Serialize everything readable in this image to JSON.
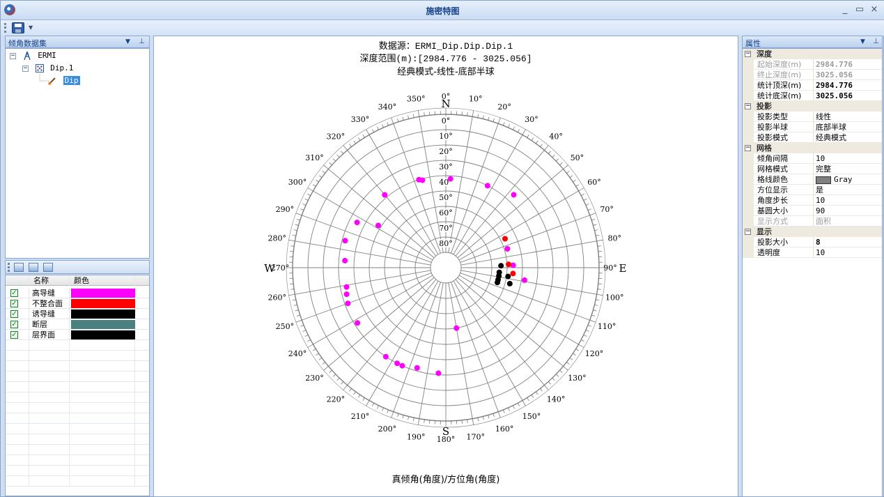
{
  "window": {
    "title": "施密特图"
  },
  "titlebar": {
    "minimize": "_",
    "maximize": "▭",
    "close": "×"
  },
  "left_panel": {
    "title": "倾角数据集",
    "tree": [
      {
        "label": "ERMI",
        "icon": "well-icon",
        "level": 0
      },
      {
        "label": "Dip.1",
        "icon": "dataset-icon",
        "level": 1
      },
      {
        "label": "Dip",
        "icon": "curve-icon",
        "level": 2,
        "selected": true
      }
    ]
  },
  "legend": {
    "headers": [
      "名称",
      "颜色"
    ],
    "items": [
      {
        "name": "高导缝",
        "color": "#ff00ff",
        "checked": true
      },
      {
        "name": "不整合面",
        "color": "#ff0000",
        "checked": true
      },
      {
        "name": "诱导缝",
        "color": "#000000",
        "checked": true
      },
      {
        "name": "断层",
        "color": "#4a8080",
        "checked": true
      },
      {
        "name": "层界面",
        "color": "#000000",
        "checked": true
      }
    ]
  },
  "chart_header": {
    "line1": "数据源：ERMI_Dip.Dip.Dip.1",
    "line2": "深度范围(m):[2984.776 - 3025.056]",
    "line3": "经典模式-线性-底部半球"
  },
  "chart_data": {
    "type": "scatter",
    "projection": "polar stereonet, linear, lower hemisphere",
    "xlabel": "真倾角(角度)/方位角(角度)",
    "cardinals": {
      "N": "N",
      "E": "E",
      "S": "S",
      "W": "W"
    },
    "azimuth_ticks": [
      "0°",
      "10°",
      "20°",
      "30°",
      "40°",
      "50°",
      "60°",
      "70°",
      "80°",
      "90°",
      "100°",
      "110°",
      "120°",
      "130°",
      "140°",
      "150°",
      "160°",
      "170°",
      "180°",
      "190°",
      "200°",
      "210°",
      "220°",
      "230°",
      "240°",
      "250°",
      "260°",
      "270°",
      "280°",
      "290°",
      "300°",
      "310°",
      "320°",
      "330°",
      "340°",
      "350°"
    ],
    "dip_ticks": [
      "0°",
      "10°",
      "20°",
      "30°",
      "40°",
      "50°",
      "60°",
      "70°",
      "80°"
    ],
    "dip_range": [
      0,
      90
    ],
    "grid_color": "#808080",
    "series": [
      {
        "name": "高导缝",
        "color": "#ff00ff",
        "points": [
          {
            "azimuth": 3,
            "dip": 42
          },
          {
            "azimuth": 343,
            "dip": 40
          },
          {
            "azimuth": 345,
            "dip": 41
          },
          {
            "azimuth": 27,
            "dip": 40
          },
          {
            "azimuth": 43,
            "dip": 35
          },
          {
            "azimuth": 320,
            "dip": 38
          },
          {
            "azimuth": 297,
            "dip": 35
          },
          {
            "azimuth": 285,
            "dip": 32
          },
          {
            "azimuth": 302,
            "dip": 48
          },
          {
            "azimuth": 274,
            "dip": 34
          },
          {
            "azimuth": 259,
            "dip": 34
          },
          {
            "azimuth": 255,
            "dip": 33
          },
          {
            "azimuth": 250,
            "dip": 32
          },
          {
            "azimuth": 238,
            "dip": 32
          },
          {
            "azimuth": 214,
            "dip": 30
          },
          {
            "azimuth": 207,
            "dip": 30
          },
          {
            "azimuth": 204,
            "dip": 30
          },
          {
            "azimuth": 196,
            "dip": 32
          },
          {
            "azimuth": 184,
            "dip": 31
          },
          {
            "azimuth": 170,
            "dip": 60
          },
          {
            "azimuth": 73,
            "dip": 58
          },
          {
            "azimuth": 88,
            "dip": 56
          },
          {
            "azimuth": 99,
            "dip": 48
          }
        ]
      },
      {
        "name": "不整合面",
        "color": "#ff0000",
        "points": [
          {
            "azimuth": 64,
            "dip": 57
          },
          {
            "azimuth": 87,
            "dip": 59
          },
          {
            "azimuth": 95,
            "dip": 56
          }
        ]
      },
      {
        "name": "诱导缝",
        "color": "#000000",
        "points": [
          {
            "azimuth": 88,
            "dip": 64
          },
          {
            "azimuth": 95,
            "dip": 65
          },
          {
            "azimuth": 99,
            "dip": 65
          },
          {
            "azimuth": 103,
            "dip": 65
          },
          {
            "azimuth": 106,
            "dip": 65
          },
          {
            "azimuth": 98,
            "dip": 59
          },
          {
            "azimuth": 104,
            "dip": 57
          }
        ]
      }
    ]
  },
  "right_panel": {
    "title": "属性",
    "categories": [
      {
        "label": "深度",
        "rows": [
          {
            "name": "起始深度(m)",
            "value": "2984.776",
            "readonly": true,
            "bold": true
          },
          {
            "name": "终止深度(m)",
            "value": "3025.056",
            "readonly": true,
            "bold": true
          },
          {
            "name": "统计顶深(m)",
            "value": "2984.776",
            "bold": true
          },
          {
            "name": "统计底深(m)",
            "value": "3025.056",
            "bold": true
          }
        ]
      },
      {
        "label": "投影",
        "rows": [
          {
            "name": "投影类型",
            "value": "线性"
          },
          {
            "name": "投影半球",
            "value": "底部半球"
          },
          {
            "name": "投影模式",
            "value": "经典模式"
          }
        ]
      },
      {
        "label": "网格",
        "rows": [
          {
            "name": "倾角间隔",
            "value": "10"
          },
          {
            "name": "网格模式",
            "value": "完整"
          },
          {
            "name": "格线颜色",
            "value": "Gray",
            "swatch": "#808080"
          },
          {
            "name": "方位显示",
            "value": "是"
          },
          {
            "name": "角度步长",
            "value": "10"
          },
          {
            "name": "基圆大小",
            "value": "90"
          },
          {
            "name": "显示方式",
            "value": "面积",
            "readonly": true
          }
        ]
      },
      {
        "label": "显示",
        "rows": [
          {
            "name": "投影大小",
            "value": "8",
            "bold": true
          },
          {
            "name": "透明度",
            "value": "10"
          }
        ]
      }
    ]
  }
}
